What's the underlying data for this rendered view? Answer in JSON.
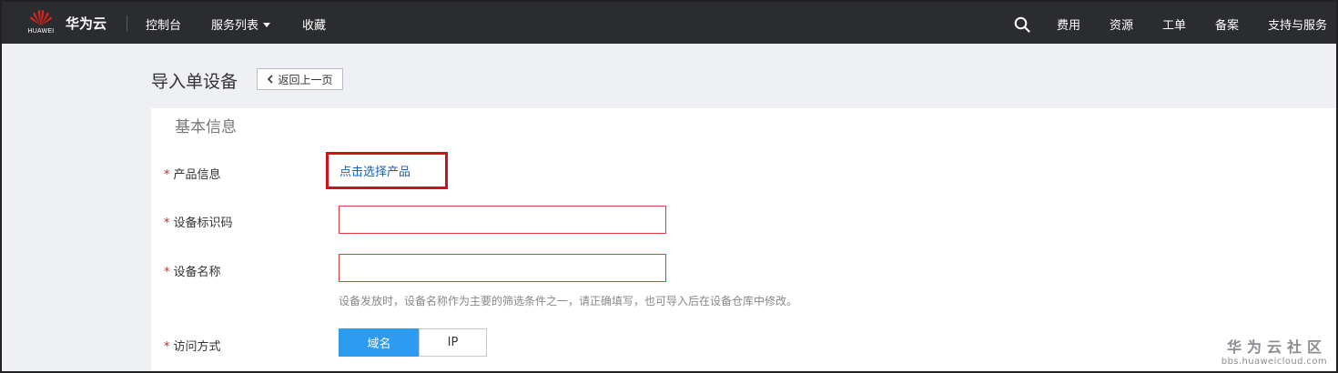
{
  "header": {
    "logo_text": "HUAWEI",
    "brand": "华为云",
    "nav_left": [
      "控制台",
      "服务列表",
      "收藏"
    ],
    "nav_right": [
      "费用",
      "资源",
      "工单",
      "备案",
      "支持与服务"
    ]
  },
  "page": {
    "title": "导入单设备",
    "back_label": "返回上一页",
    "section_title": "基本信息"
  },
  "form": {
    "product": {
      "label": "产品信息",
      "link": "点击选择产品"
    },
    "device_id": {
      "label": "设备标识码",
      "value": ""
    },
    "device_name": {
      "label": "设备名称",
      "value": "",
      "hint": "设备发放时，设备名称作为主要的筛选条件之一，请正确填写，也可导入后在设备仓库中修改。"
    },
    "access": {
      "label": "访问方式",
      "options": [
        "域名",
        "IP"
      ],
      "selected": "域名"
    },
    "required_mark": "*"
  },
  "watermark": {
    "title": "华为云社区",
    "url": "bbs.huaweicloud.com"
  },
  "colors": {
    "topbar": "#2b2c30",
    "accent": "#2d9bf0",
    "highlight": "#d0101b",
    "link": "#1a5fb4"
  }
}
